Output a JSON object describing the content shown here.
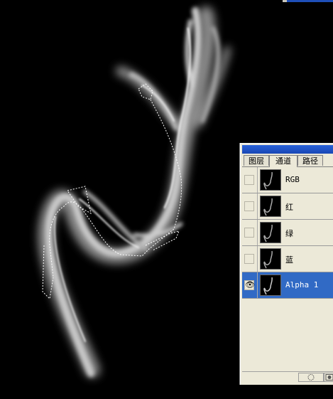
{
  "palette": {
    "tabs": [
      "图层",
      "通道",
      "路径"
    ],
    "active_tab": "通道",
    "channels": [
      {
        "label": "RGB",
        "visible": false,
        "selected": false
      },
      {
        "label": "红",
        "visible": false,
        "selected": false
      },
      {
        "label": "绿",
        "visible": false,
        "selected": false
      },
      {
        "label": "蓝",
        "visible": false,
        "selected": false
      },
      {
        "label": "Alpha 1",
        "visible": true,
        "selected": true
      }
    ],
    "eye_glyph": "👁",
    "footer_icons": [
      "load-selection-icon",
      "save-selection-icon"
    ]
  },
  "colors": {
    "accent": "#316ac5",
    "titlebar": "#2a62d8",
    "panel_bg": "#ece9d8",
    "canvas_bg": "#000000"
  }
}
